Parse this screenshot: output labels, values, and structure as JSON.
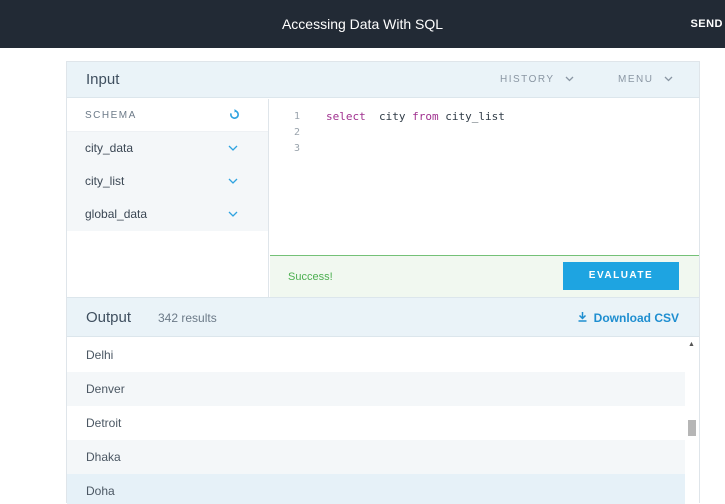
{
  "topbar": {
    "title": "Accessing Data With SQL",
    "send_label": "SEND"
  },
  "input": {
    "label": "Input",
    "history_label": "HISTORY",
    "menu_label": "MENU"
  },
  "schema": {
    "header": "SCHEMA",
    "items": [
      {
        "label": "city_data"
      },
      {
        "label": "city_list"
      },
      {
        "label": "global_data"
      }
    ]
  },
  "editor": {
    "lines": [
      {
        "num": "1",
        "keyword1": "select",
        "mid": "  city ",
        "keyword2": "from",
        "rest": " city_list"
      },
      {
        "num": "2"
      },
      {
        "num": "3"
      }
    ]
  },
  "status": {
    "text": "Success!",
    "evaluate_label": "EVALUATE"
  },
  "output": {
    "label": "Output",
    "count": "342 results",
    "download_label": "Download CSV",
    "rows": [
      "Delhi",
      "Denver",
      "Detroit",
      "Dhaka",
      "Doha"
    ]
  },
  "colors": {
    "accent": "#1ea4e1",
    "success": "#4caf50",
    "topbar": "#222a35"
  },
  "icons": {
    "refresh": "refresh-icon",
    "chevron": "chevron-down-icon",
    "download": "download-icon"
  }
}
